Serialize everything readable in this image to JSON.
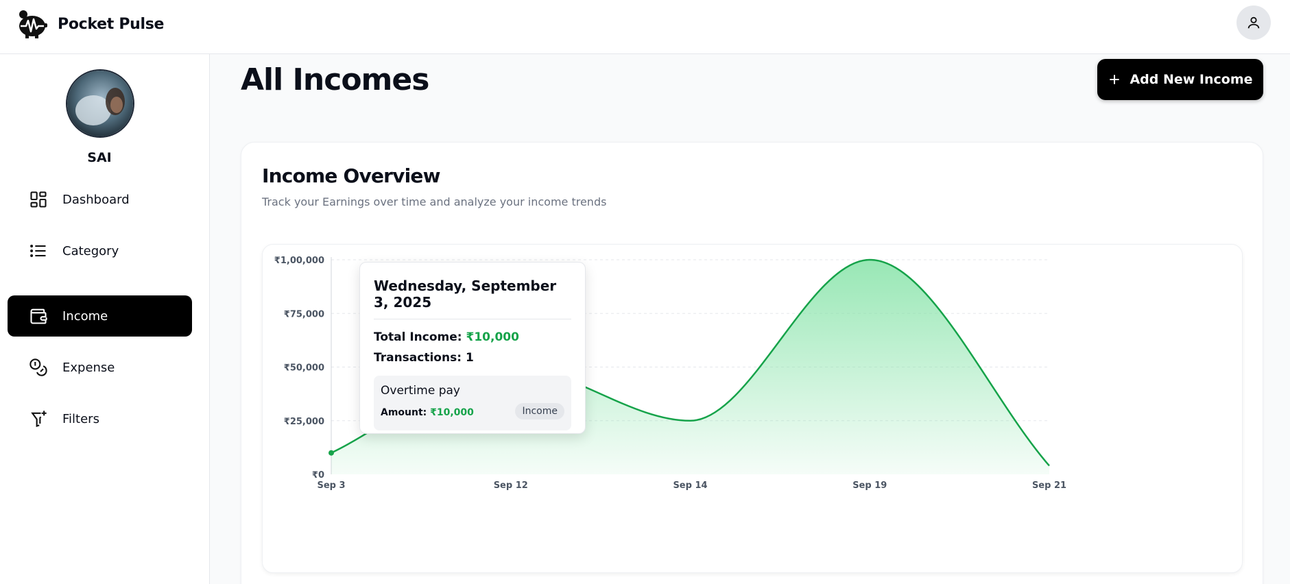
{
  "header": {
    "app_name": "Pocket Pulse",
    "logo_icon": "piggy-bank-pulse-icon",
    "user_icon": "user-icon"
  },
  "sidebar": {
    "username": "SAI",
    "items": [
      {
        "label": "Dashboard",
        "icon": "dashboard-icon",
        "active": false
      },
      {
        "label": "Category",
        "icon": "list-icon",
        "active": false
      },
      {
        "label": "Income",
        "icon": "wallet-icon",
        "active": true
      },
      {
        "label": "Expense",
        "icon": "coins-icon",
        "active": false
      },
      {
        "label": "Filters",
        "icon": "filter-plus-icon",
        "active": false
      }
    ]
  },
  "main": {
    "title": "All Incomes",
    "add_button_label": "Add New Income",
    "card": {
      "title": "Income Overview",
      "subtitle": "Track your Earnings over time and analyze your income trends"
    }
  },
  "tooltip": {
    "date": "Wednesday, September 3, 2025",
    "total_label": "Total Income:",
    "total_value": "₹10,000",
    "transactions_label": "Transactions:",
    "transactions_value": "1",
    "item": {
      "name": "Overtime pay",
      "amount_label": "Amount:",
      "amount_value": "₹10,000",
      "badge": "Income"
    }
  },
  "colors": {
    "accent": "#16a34a",
    "active_nav": "#000000",
    "fill_top": "#86e3a8"
  },
  "chart_data": {
    "type": "area",
    "categories": [
      "Sep 3",
      "Sep 12",
      "Sep 14",
      "Sep 19",
      "Sep 21"
    ],
    "values": [
      10000,
      50000,
      25000,
      100000,
      4000
    ],
    "y_tick_labels": [
      "₹0",
      "₹25,000",
      "₹50,000",
      "₹75,000",
      "₹1,00,000"
    ],
    "y_ticks": [
      0,
      25000,
      50000,
      75000,
      100000
    ],
    "ylim": [
      0,
      100000
    ],
    "grid": true,
    "highlighted_point": 0
  }
}
